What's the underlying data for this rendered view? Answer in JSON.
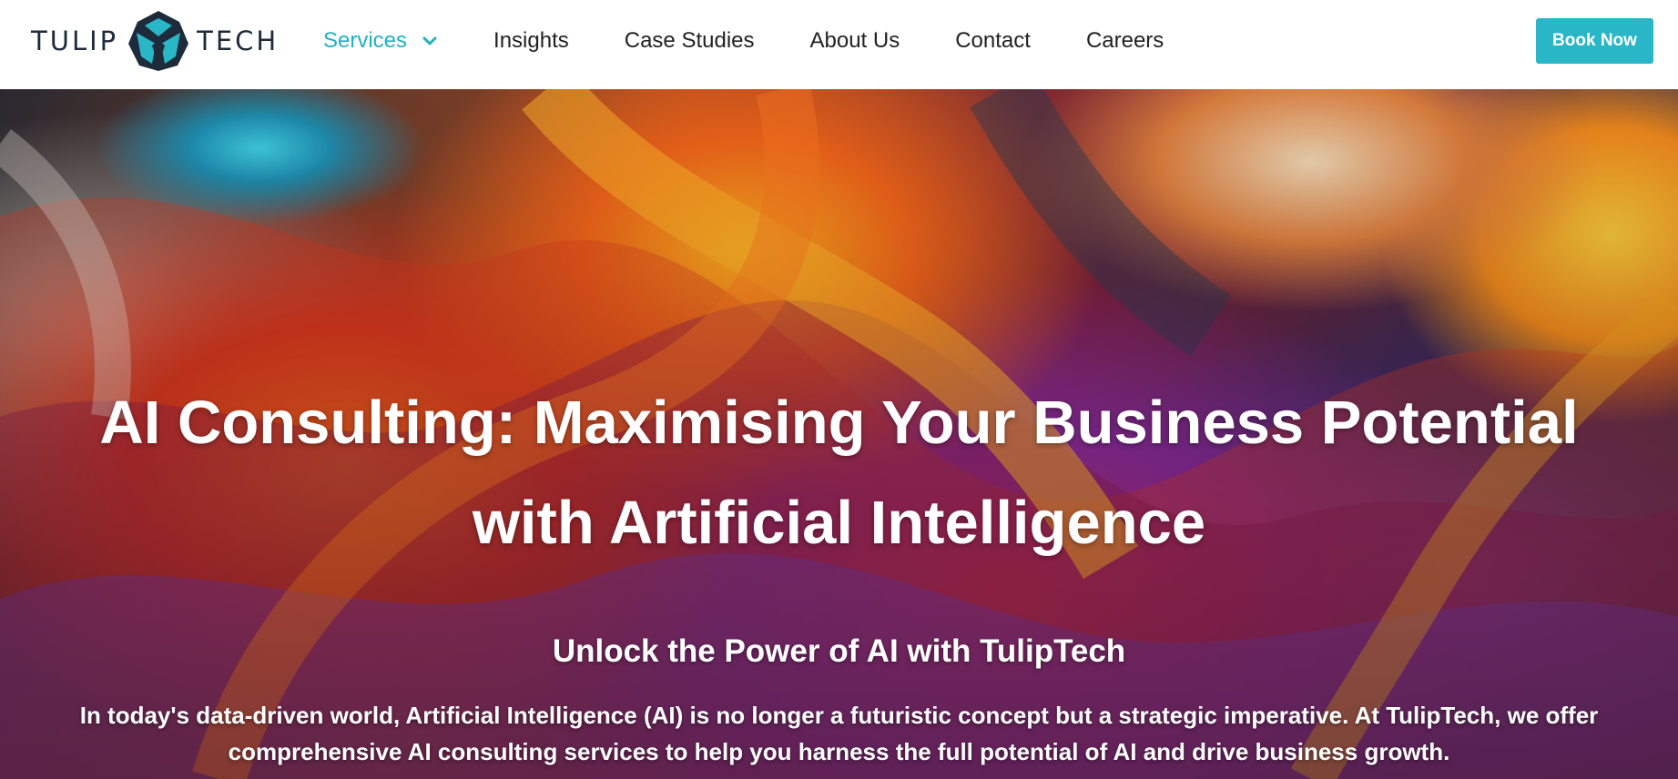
{
  "brand": {
    "name_left": "TULIP",
    "name_right": "TECH",
    "logo_icon": "tuliptech-diamond-logo",
    "colors": {
      "teal": "#29b7c8",
      "navy": "#1d2b3a"
    }
  },
  "nav": {
    "items": [
      {
        "label": "Services",
        "active": true,
        "has_dropdown": true
      },
      {
        "label": "Insights"
      },
      {
        "label": "Case Studies"
      },
      {
        "label": "About Us"
      },
      {
        "label": "Contact"
      },
      {
        "label": "Careers"
      }
    ],
    "cta_label": "Book Now"
  },
  "hero": {
    "title": "AI Consulting: Maximising Your Business Potential with Artificial Intelligence",
    "subtitle": "Unlock the Power of AI with TulipTech",
    "body": "In today's data-driven world, Artificial Intelligence (AI) is no longer a futuristic concept but a strategic imperative. At TulipTech, we offer comprehensive AI consulting services to help you harness the full potential of AI and drive business growth."
  }
}
